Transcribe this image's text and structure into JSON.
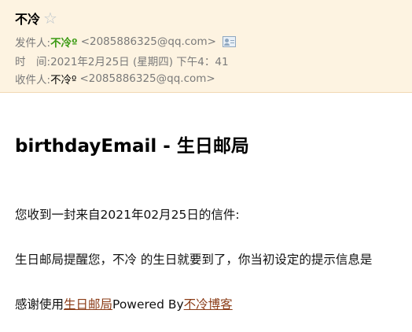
{
  "header": {
    "subject": "不冷",
    "star_glyph": "☆",
    "from": {
      "label": "发件人:",
      "name": "不冷º",
      "address": "<2085886325@qq.com>"
    },
    "time": {
      "label": "时　间:",
      "value": "2021年2月25日 (星期四) 下午4：41"
    },
    "to": {
      "label": "收件人:",
      "name": "不冷º",
      "address": "<2085886325@qq.com>"
    }
  },
  "body": {
    "title": "birthdayEmail - 生日邮局",
    "line1": "您收到一封来自2021年02月25日的信件:",
    "line2": "生日邮局提醒您，不冷 的生日就要到了，你当初设定的提示信息是",
    "footer": {
      "prefix": "感谢使用",
      "link1": "生日邮局",
      "middle": "Powered By",
      "link2": "不冷博客"
    }
  },
  "colors": {
    "header_bg": "#fdf3e1",
    "sender_green": "#3a9a12",
    "link_brown": "#8b3c17"
  },
  "icons": {
    "star": "star-outline-icon",
    "contact": "contact-card-icon"
  }
}
